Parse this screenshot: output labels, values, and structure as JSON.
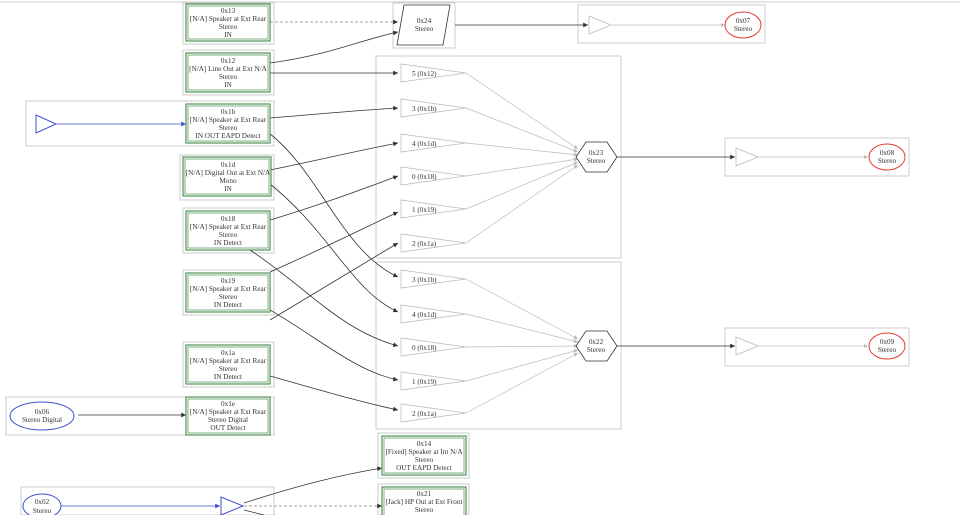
{
  "nodes": {
    "n13": {
      "id": "0x13",
      "lines": [
        "[N/A] Speaker at Ext Rear",
        "Stereo",
        "IN"
      ]
    },
    "n12": {
      "id": "0x12",
      "lines": [
        "[N/A] Line Out at Ext N/A",
        "Stereo",
        "IN"
      ]
    },
    "n1b": {
      "id": "0x1b",
      "lines": [
        "[N/A] Speaker at Ext Rear",
        "Stereo",
        "IN OUT EAPD Detect"
      ]
    },
    "n1d": {
      "id": "0x1d",
      "lines": [
        "[N/A] Digital Out at Ext N/A",
        "Mono",
        "IN"
      ]
    },
    "n18": {
      "id": "0x18",
      "lines": [
        "[N/A] Speaker at Ext Rear",
        "Stereo",
        "IN Detect"
      ]
    },
    "n19": {
      "id": "0x19",
      "lines": [
        "[N/A] Speaker at Ext Rear",
        "Stereo",
        "IN Detect"
      ]
    },
    "n1a": {
      "id": "0x1a",
      "lines": [
        "[N/A] Speaker at Ext Rear",
        "Stereo",
        "IN Detect"
      ]
    },
    "n1e": {
      "id": "0x1e",
      "lines": [
        "[N/A] Speaker at Ext Rear",
        "Stereo Digital",
        "OUT Detect"
      ]
    },
    "n14": {
      "id": "0x14",
      "lines": [
        "[Fixed] Speaker at Int N/A",
        "Stereo",
        "OUT EAPD Detect"
      ]
    },
    "n21": {
      "id": "0x21",
      "lines": [
        "[Jack] HP Out at Ext Front",
        "Stereo"
      ]
    },
    "n24": {
      "id": "0x24",
      "lines": [
        "Stereo"
      ]
    },
    "n07": {
      "id": "0x07",
      "lines": [
        "Stereo"
      ]
    },
    "n08": {
      "id": "0x08",
      "lines": [
        "Stereo"
      ]
    },
    "n09": {
      "id": "0x09",
      "lines": [
        "Stereo"
      ]
    },
    "n06": {
      "id": "0x06",
      "lines": [
        "Stereo Digital"
      ]
    },
    "n02": {
      "id": "0x02",
      "lines": [
        "Stereo"
      ]
    },
    "n23": {
      "id": "0x23",
      "lines": [
        "Stereo"
      ]
    },
    "n22": {
      "id": "0x22",
      "lines": [
        "Stereo"
      ]
    }
  },
  "mixer_inputs_top": [
    "5 (0x12)",
    "3 (0x1b)",
    "4 (0x1d)",
    "0 (0x18)",
    "1 (0x19)",
    "2 (0x1a)"
  ],
  "mixer_inputs_bottom": [
    "3 (0x1b)",
    "4 (0x1d)",
    "0 (0x18)",
    "1 (0x19)",
    "2 (0x1a)"
  ],
  "colors": {
    "pin_border": "#2e7d32",
    "edge": "#333333",
    "edge_light": "#bbbbbb",
    "amp_blue": "#3b4fd0",
    "out_red": "#e53935",
    "group_border": "#cccccc"
  }
}
